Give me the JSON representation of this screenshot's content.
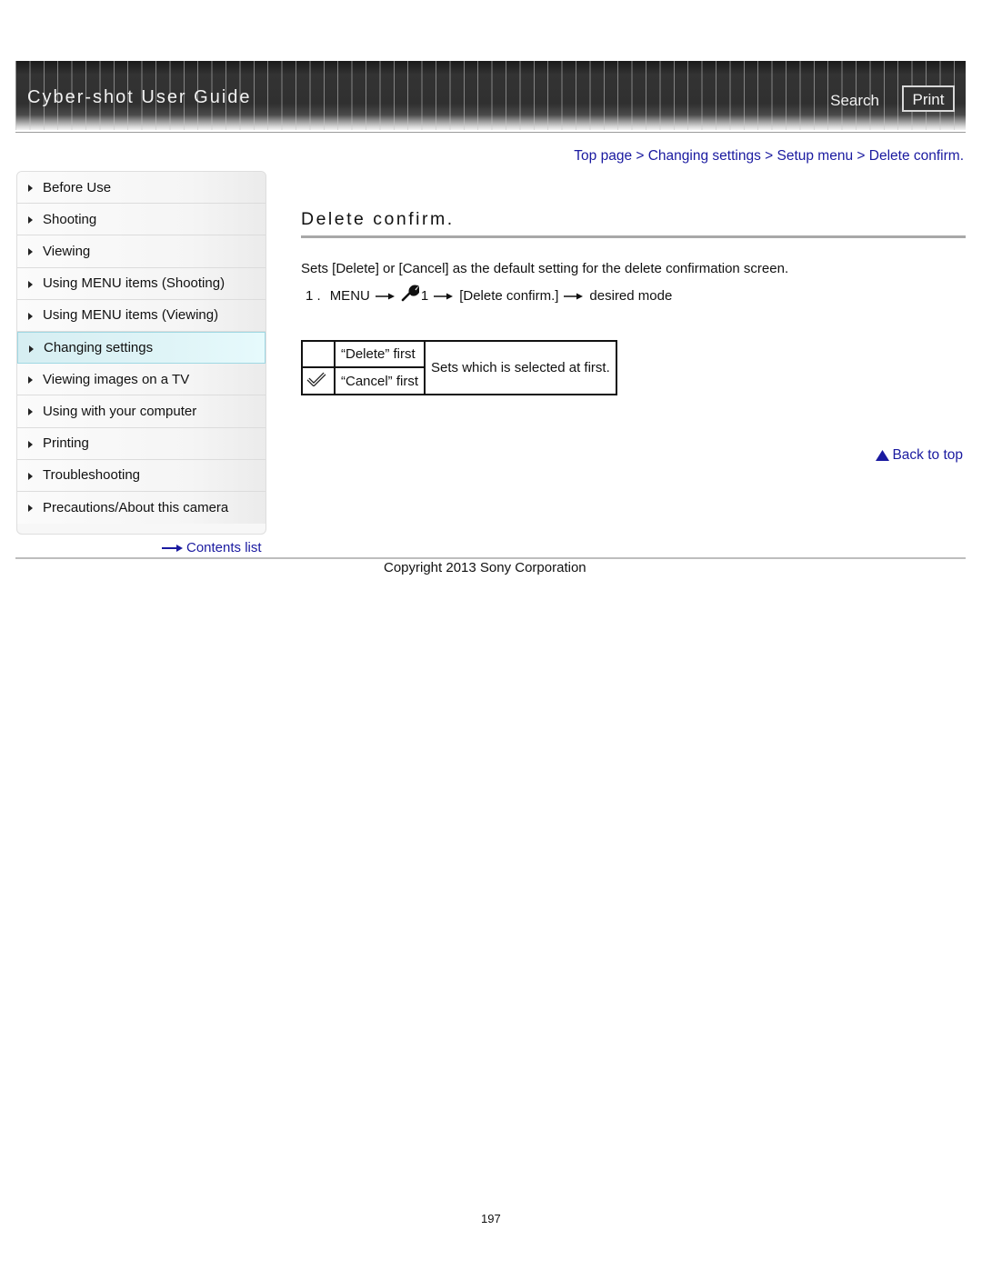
{
  "header": {
    "title": "Cyber-shot User Guide",
    "search_label": "Search",
    "print_label": "Print"
  },
  "breadcrumb": {
    "items": [
      "Top page",
      "Changing settings",
      "Setup menu",
      "Delete confirm."
    ],
    "separator": ">"
  },
  "sidebar": {
    "items": [
      {
        "label": "Before Use"
      },
      {
        "label": "Shooting"
      },
      {
        "label": "Viewing"
      },
      {
        "label": "Using MENU items (Shooting)"
      },
      {
        "label": "Using MENU items (Viewing)"
      },
      {
        "label": "Changing settings",
        "active": true
      },
      {
        "label": "Viewing images on a TV"
      },
      {
        "label": "Using with your computer"
      },
      {
        "label": "Printing"
      },
      {
        "label": "Troubleshooting"
      },
      {
        "label": "Precautions/About this camera"
      }
    ],
    "contents_link": "Contents list"
  },
  "main": {
    "title": "Delete confirm.",
    "description": "Sets [Delete] or [Cancel] as the default setting for the delete confirmation screen.",
    "step": {
      "number": "1 .",
      "menu": "MENU",
      "setup_icon": "wrench-icon",
      "setup_number": "1",
      "item": "[Delete confirm.]",
      "target": "desired mode"
    },
    "table": {
      "rows": [
        {
          "default": false,
          "option": "“Delete” first"
        },
        {
          "default": true,
          "option": "“Cancel” first"
        }
      ],
      "description": "Sets which is selected at first."
    },
    "back_to_top": "Back to top"
  },
  "footer": {
    "copyright": "Copyright 2013 Sony Corporation",
    "page_number": "197"
  },
  "colors": {
    "link": "#1a1aa0",
    "active_nav": "#dff4f7"
  }
}
